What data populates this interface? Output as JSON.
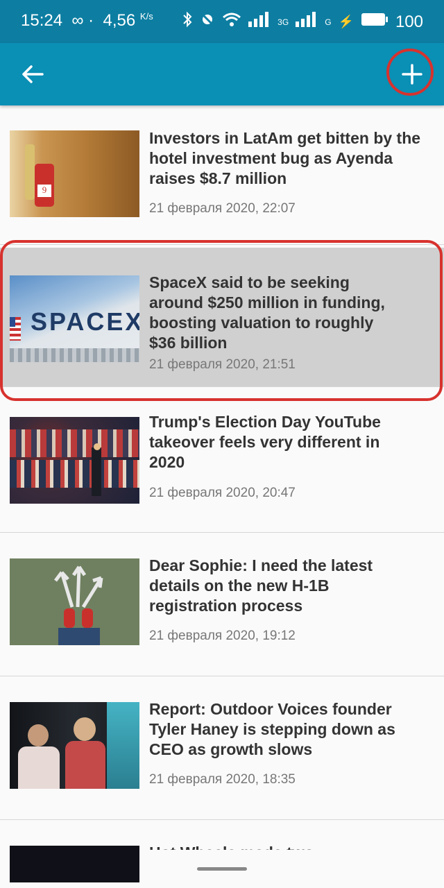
{
  "status_bar": {
    "time": "15:24",
    "speed": "4,56",
    "speed_unit": "K/s",
    "net1": "3G",
    "net2": "G",
    "battery": "100"
  },
  "toolbar": {
    "back_icon": "arrow-left-icon",
    "add_icon": "plus-icon"
  },
  "articles": [
    {
      "title": "Investors in LatAm get bitten by the hotel investment bug as Ayenda raises $8.7 million",
      "date": "21 февраля 2020, 22:07",
      "thumb_text": "9"
    },
    {
      "title": "SpaceX said to be seeking around $250 million in funding, boosting valuation to roughly $36 billion",
      "date": "21 февраля 2020, 21:51",
      "thumb_text": "SPACEX"
    },
    {
      "title": "Trump's Election Day YouTube takeover feels very different in 2020",
      "date": "21 февраля 2020, 20:47"
    },
    {
      "title": "Dear Sophie: I need the latest details on the new H-1B registration process",
      "date": "21 февраля 2020, 19:12"
    },
    {
      "title": "Report: Outdoor Voices founder Tyler Haney is stepping down as CEO as growth slows",
      "date": "21 февраля 2020, 18:35"
    },
    {
      "title": "Hot Wheels made two"
    }
  ],
  "colors": {
    "primary": "#0a8fb5",
    "status": "#0d7ea2",
    "annotation": "#d7322e"
  }
}
